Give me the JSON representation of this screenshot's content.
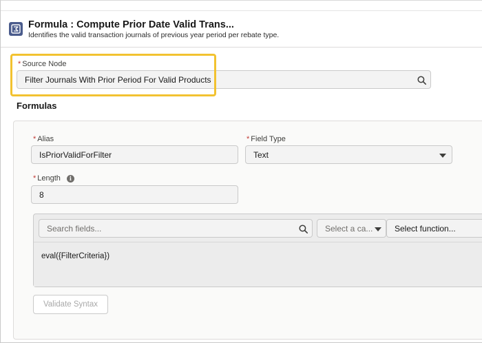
{
  "header": {
    "title": "Formula :  Compute Prior Date Valid Trans...",
    "subtitle": "Identifies the valid transaction journals of previous year period per rebate type.",
    "icon": "formula-icon",
    "icon_color": "#4a5b8c"
  },
  "source_node": {
    "label": "Source Node",
    "required_mark": "*",
    "value": "Filter Journals With Prior Period For Valid Products",
    "highlight_color": "#f2c230"
  },
  "formulas": {
    "section_title": "Formulas",
    "alias": {
      "label": "Alias",
      "required_mark": "*",
      "value": "IsPriorValidForFilter"
    },
    "field_type": {
      "label": "Field Type",
      "required_mark": "*",
      "value": "Text"
    },
    "length": {
      "label": "Length",
      "required_mark": "*",
      "value": "8",
      "info_glyph": "i"
    },
    "editor": {
      "search_placeholder": "Search fields...",
      "category_placeholder": "Select a ca...",
      "function_placeholder": "Select function...",
      "expression": "eval({FilterCriteria})"
    },
    "validate_label": "Validate Syntax"
  }
}
